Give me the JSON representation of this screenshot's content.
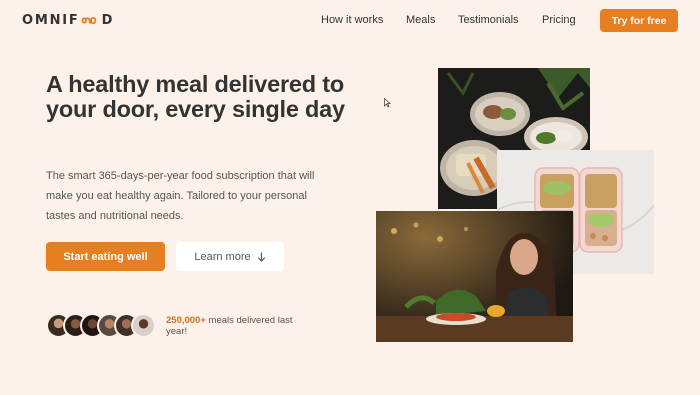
{
  "header": {
    "logo_left": "OMNIF",
    "logo_right": "D",
    "nav": [
      "How it works",
      "Meals",
      "Testimonials",
      "Pricing"
    ],
    "cta": "Try for free"
  },
  "hero": {
    "headline": "A healthy meal delivered to your door, every single day",
    "description": "The smart 365-days-per-year food subscription that will make you eat healthy again. Tailored to your personal tastes and nutritional needs.",
    "primary_button": "Start eating well",
    "secondary_button": "Learn more",
    "secondary_icon": "arrow-down-icon"
  },
  "delivered": {
    "count": "250,000+",
    "text": " meals delivered last year!"
  },
  "colors": {
    "accent": "#e67e22",
    "background": "#fdf2e9",
    "text": "#333333"
  }
}
